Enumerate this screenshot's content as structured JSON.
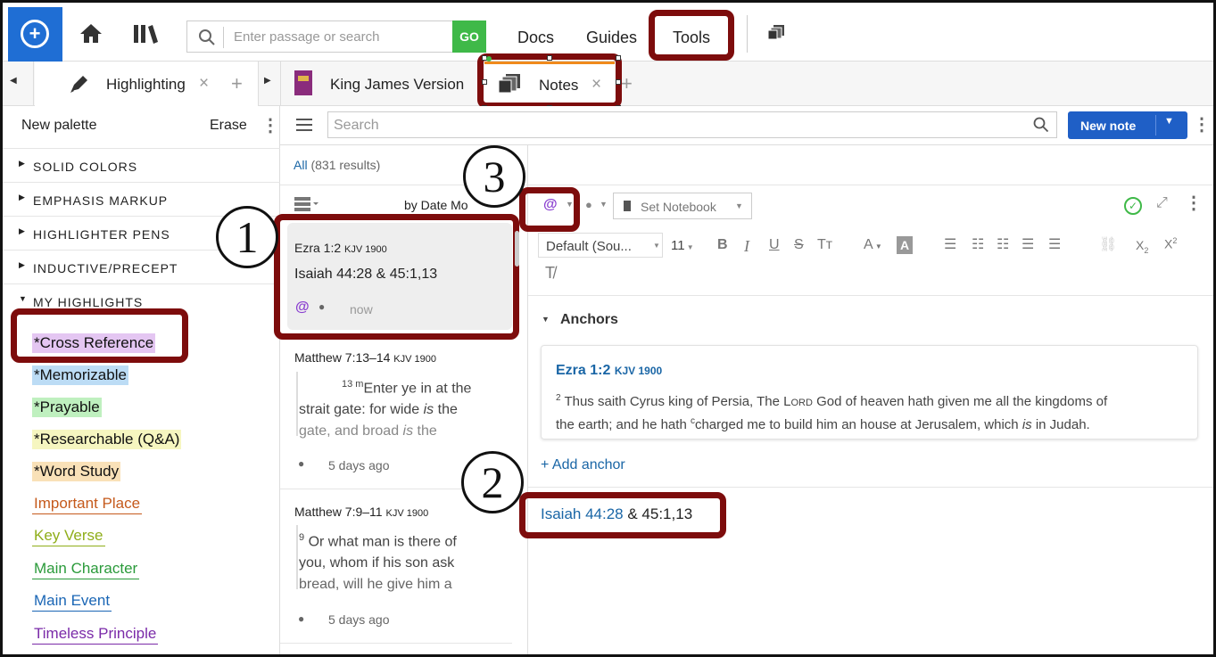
{
  "top": {
    "search_placeholder": "Enter passage or search",
    "go": "GO",
    "links": [
      "Docs",
      "Guides",
      "Tools"
    ]
  },
  "tabs": {
    "left": {
      "label": "Highlighting",
      "close": "×",
      "add": "+"
    },
    "right": [
      {
        "label": "King James Version"
      },
      {
        "label": "Notes",
        "close": "×"
      }
    ],
    "add": "+"
  },
  "left": {
    "new_palette": "New palette",
    "erase": "Erase",
    "sections": [
      "SOLID COLORS",
      "EMPHASIS MARKUP",
      "HIGHLIGHTER PENS",
      "INDUCTIVE/PRECEPT",
      "MY HIGHLIGHTS"
    ],
    "items": [
      {
        "label": "*Cross Reference",
        "bg": "#e4c6f2",
        "color": "#111",
        "underline": ""
      },
      {
        "label": "*Memorizable",
        "bg": "#bcdcf5",
        "color": "#111",
        "underline": ""
      },
      {
        "label": "*Prayable",
        "bg": "#bff0bf",
        "color": "#111",
        "underline": ""
      },
      {
        "label": "*Researchable (Q&A)",
        "bg": "#f6f6c0",
        "color": "#111",
        "underline": ""
      },
      {
        "label": "*Word Study",
        "bg": "#f9e1b8",
        "color": "#111",
        "underline": ""
      },
      {
        "label": "Important Place",
        "bg": "",
        "color": "#c55a1c",
        "underline": "#c55a1c"
      },
      {
        "label": "Key Verse",
        "bg": "",
        "color": "#8fae1a",
        "underline": "#8fae1a"
      },
      {
        "label": "Main Character",
        "bg": "",
        "color": "#2a9a3a",
        "underline": "#2a9a3a"
      },
      {
        "label": "Main Event",
        "bg": "",
        "color": "#1a66b5",
        "underline": "#1a66b5"
      },
      {
        "label": "Timeless Principle",
        "bg": "",
        "color": "#7a2aa8",
        "underline": "#7a2aa8"
      }
    ]
  },
  "notes": {
    "search_placeholder": "Search",
    "new_note": "New note",
    "filter_all": "All",
    "results": "(831 results)",
    "sort": "by Date Mo",
    "cards": [
      {
        "ref": "Ezra 1:2",
        "ver": "KJV 1900",
        "text": "Isaiah 44:28 & 45:1,13",
        "time": "now"
      },
      {
        "ref": "Matthew 7:13–14",
        "ver": "KJV 1900",
        "sup": "13 m",
        "text1": "Enter ye in at the",
        "text2": "strait gate: for wide ",
        "text2i": "is",
        "text2b": " the",
        "text3": "gate, and broad ",
        "text3i": "is",
        "text3b": " the",
        "time": "5 days ago"
      },
      {
        "ref": "Matthew 7:9–11",
        "ver": "KJV 1900",
        "sup": "9",
        "text1": " Or what man is there of",
        "text2": "you, whom if his son ask",
        "text3": "bread, will he give him a",
        "time": "5 days ago"
      }
    ]
  },
  "editor": {
    "set_notebook": "Set Notebook",
    "font": "Default (Sou...",
    "size": "11",
    "anchors_title": "Anchors",
    "anchor_ref": "Ezra 1:2",
    "anchor_ver": "KJV 1900",
    "anchor_text_pre": " Thus saith Cyrus king of Persia, The ",
    "lord": "Lord",
    "anchor_text_post": " God of heaven hath given me all the kingdoms of",
    "anchor_line2a": "the earth; and he hath ",
    "anchor_line2sup": "c",
    "anchor_line2b": "charged me to build him an house at Jerusalem, which ",
    "anchor_line2i": "is",
    "anchor_line2c": " in Judah.",
    "anchor_sup": "2",
    "add_anchor": "+ Add anchor",
    "body_link": "Isaiah 44:28",
    "body_rest": " & 45:1,13"
  },
  "callouts": [
    "1",
    "2",
    "3"
  ],
  "colors": {
    "accent": "#1f6ed4",
    "go": "#3fb948",
    "callout": "#7d0c0c",
    "link": "#1a66a6",
    "purple": "#8a3fd0"
  }
}
